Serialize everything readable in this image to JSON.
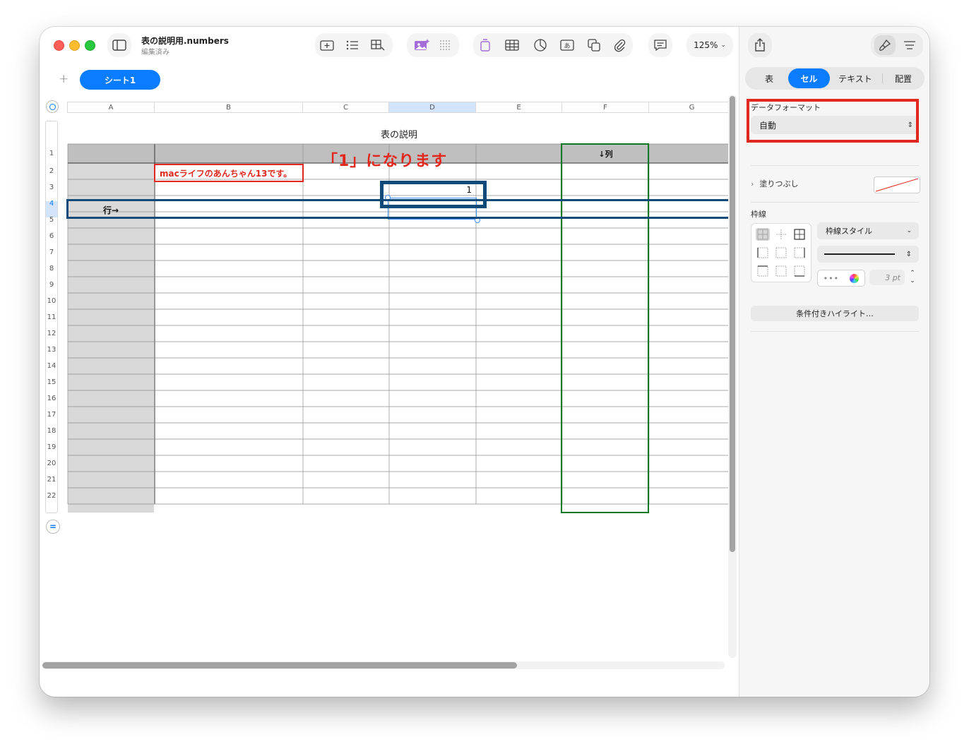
{
  "window": {
    "title": "表の説明用.numbers",
    "subtitle": "編集済み",
    "zoom": "125%"
  },
  "sheets": {
    "add_label": "+",
    "tabs": [
      {
        "label": "シート1",
        "active": true
      }
    ]
  },
  "table": {
    "title": "表の説明",
    "columns": [
      "A",
      "B",
      "C",
      "D",
      "E",
      "F",
      "G"
    ],
    "rows": [
      "1",
      "2",
      "3",
      "4",
      "5",
      "6",
      "7",
      "8",
      "9",
      "10",
      "11",
      "12",
      "13",
      "14",
      "15",
      "16",
      "17",
      "18",
      "19",
      "20",
      "21",
      "22"
    ],
    "cells": {
      "F1": "↓列",
      "A4": "行→",
      "D3": "1"
    }
  },
  "annotations": {
    "red_box_text": "macライフのあんちゃん13です。",
    "big_red_text": "「1」になります"
  },
  "inspector": {
    "tabs": [
      {
        "label": "表"
      },
      {
        "label": "セル",
        "active": true
      },
      {
        "label": "テキスト"
      },
      {
        "label": "配置"
      }
    ],
    "data_format_label": "データフォーマット",
    "data_format_value": "自動",
    "fill_label": "塗りつぶし",
    "border_label": "枠線",
    "border_style_value": "枠線スタイル",
    "border_width_value": "3 pt",
    "conditional_highlight_button": "条件付きハイライト…"
  },
  "colors": {
    "accent": "#0a7cff",
    "highlight_red": "#e0281e",
    "row_box_blue": "#0d4a7a",
    "column_box_green": "#0f7a26",
    "header_gray": "#bfbfbf",
    "first_col_gray": "#d9d9d9"
  }
}
